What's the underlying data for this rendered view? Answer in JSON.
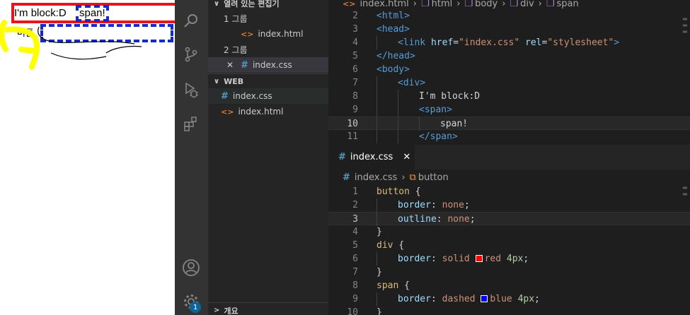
{
  "preview": {
    "div_text": "I'm block:D",
    "span_text": "span!",
    "button_label": "버튼",
    "div_color": "#e8141c",
    "span_color": "#1228d0"
  },
  "activity_bar": {
    "icons": [
      "explorer-icon",
      "search-icon",
      "source-control-icon",
      "run-debug-icon",
      "extensions-icon",
      "account-icon",
      "settings-gear-icon"
    ],
    "badge": "1"
  },
  "explorer": {
    "open_editors_header": "열려 있는 편집기",
    "group1": "1 그룹",
    "group1_file": "index.html",
    "group2": "2 그룹",
    "group2_file": "index.css",
    "close_glyph": "✕",
    "folder_header": "WEB",
    "files": [
      "index.css",
      "index.html"
    ],
    "outline_header": "개요"
  },
  "editor_top": {
    "breadcrumb": [
      "index.html",
      "html",
      "body",
      "div",
      "span"
    ],
    "lines": [
      {
        "n": "2",
        "indent": 0,
        "tokens": [
          [
            "t-tag",
            "<html>"
          ]
        ]
      },
      {
        "n": "3",
        "indent": 0,
        "tokens": [
          [
            "t-tag",
            "<head>"
          ]
        ]
      },
      {
        "n": "4",
        "indent": 1,
        "tokens": [
          [
            "t-tag",
            "<link "
          ],
          [
            "t-attr",
            "href"
          ],
          [
            "t-punc",
            "="
          ],
          [
            "t-str",
            "\"index.css\""
          ],
          [
            "t-punc",
            " "
          ],
          [
            "t-attr",
            "rel"
          ],
          [
            "t-punc",
            "="
          ],
          [
            "t-str",
            "\"stylesheet\""
          ],
          [
            "t-tag",
            ">"
          ]
        ]
      },
      {
        "n": "5",
        "indent": 0,
        "tokens": [
          [
            "t-tag",
            "</head>"
          ]
        ]
      },
      {
        "n": "6",
        "indent": 0,
        "tokens": [
          [
            "t-tag",
            "<body>"
          ]
        ]
      },
      {
        "n": "7",
        "indent": 1,
        "tokens": [
          [
            "t-tag",
            "<div>"
          ]
        ]
      },
      {
        "n": "8",
        "indent": 2,
        "tokens": [
          [
            "t-txt",
            "I'm block:D"
          ]
        ]
      },
      {
        "n": "9",
        "indent": 2,
        "tokens": [
          [
            "t-tag",
            "<span>"
          ]
        ]
      },
      {
        "n": "10",
        "indent": 3,
        "tokens": [
          [
            "t-txt",
            "span!"
          ]
        ],
        "current": true
      },
      {
        "n": "11",
        "indent": 2,
        "tokens": [
          [
            "t-tag",
            "</span>"
          ]
        ]
      }
    ]
  },
  "editor_bottom": {
    "tab_label": "index.css",
    "tab_close": "✕",
    "breadcrumb": [
      "index.css",
      "button"
    ],
    "lines": [
      {
        "n": "1",
        "indent": 0,
        "tokens": [
          [
            "t-sel",
            "button"
          ],
          [
            "t-punc",
            " {"
          ]
        ]
      },
      {
        "n": "2",
        "indent": 1,
        "tokens": [
          [
            "t-prop",
            "border"
          ],
          [
            "t-punc",
            ": "
          ],
          [
            "t-val",
            "none"
          ],
          [
            "t-punc",
            ";"
          ]
        ]
      },
      {
        "n": "3",
        "indent": 1,
        "tokens": [
          [
            "t-prop",
            "outline"
          ],
          [
            "t-punc",
            ": "
          ],
          [
            "t-val",
            "none"
          ],
          [
            "t-punc",
            ";"
          ]
        ],
        "current": true
      },
      {
        "n": "4",
        "indent": 0,
        "tokens": [
          [
            "t-punc",
            "}"
          ]
        ]
      },
      {
        "n": "5",
        "indent": 0,
        "tokens": [
          [
            "t-sel",
            "div"
          ],
          [
            "t-punc",
            " {"
          ]
        ]
      },
      {
        "n": "6",
        "indent": 1,
        "tokens": [
          [
            "t-prop",
            "border"
          ],
          [
            "t-punc",
            ": "
          ],
          [
            "t-val",
            "solid "
          ],
          [
            "swatch",
            "#ff0000"
          ],
          [
            "t-val",
            "red "
          ],
          [
            "t-num",
            "4px"
          ],
          [
            "t-punc",
            ";"
          ]
        ]
      },
      {
        "n": "7",
        "indent": 0,
        "tokens": [
          [
            "t-punc",
            "}"
          ]
        ]
      },
      {
        "n": "8",
        "indent": 0,
        "tokens": [
          [
            "t-sel",
            "span"
          ],
          [
            "t-punc",
            " {"
          ]
        ]
      },
      {
        "n": "9",
        "indent": 1,
        "tokens": [
          [
            "t-prop",
            "border"
          ],
          [
            "t-punc",
            ": "
          ],
          [
            "t-val",
            "dashed "
          ],
          [
            "swatch",
            "#0000ff"
          ],
          [
            "t-val",
            "blue "
          ],
          [
            "t-num",
            "4px"
          ],
          [
            "t-punc",
            ";"
          ]
        ]
      },
      {
        "n": "10",
        "indent": 0,
        "tokens": [
          [
            "t-punc",
            "}"
          ]
        ]
      }
    ]
  }
}
